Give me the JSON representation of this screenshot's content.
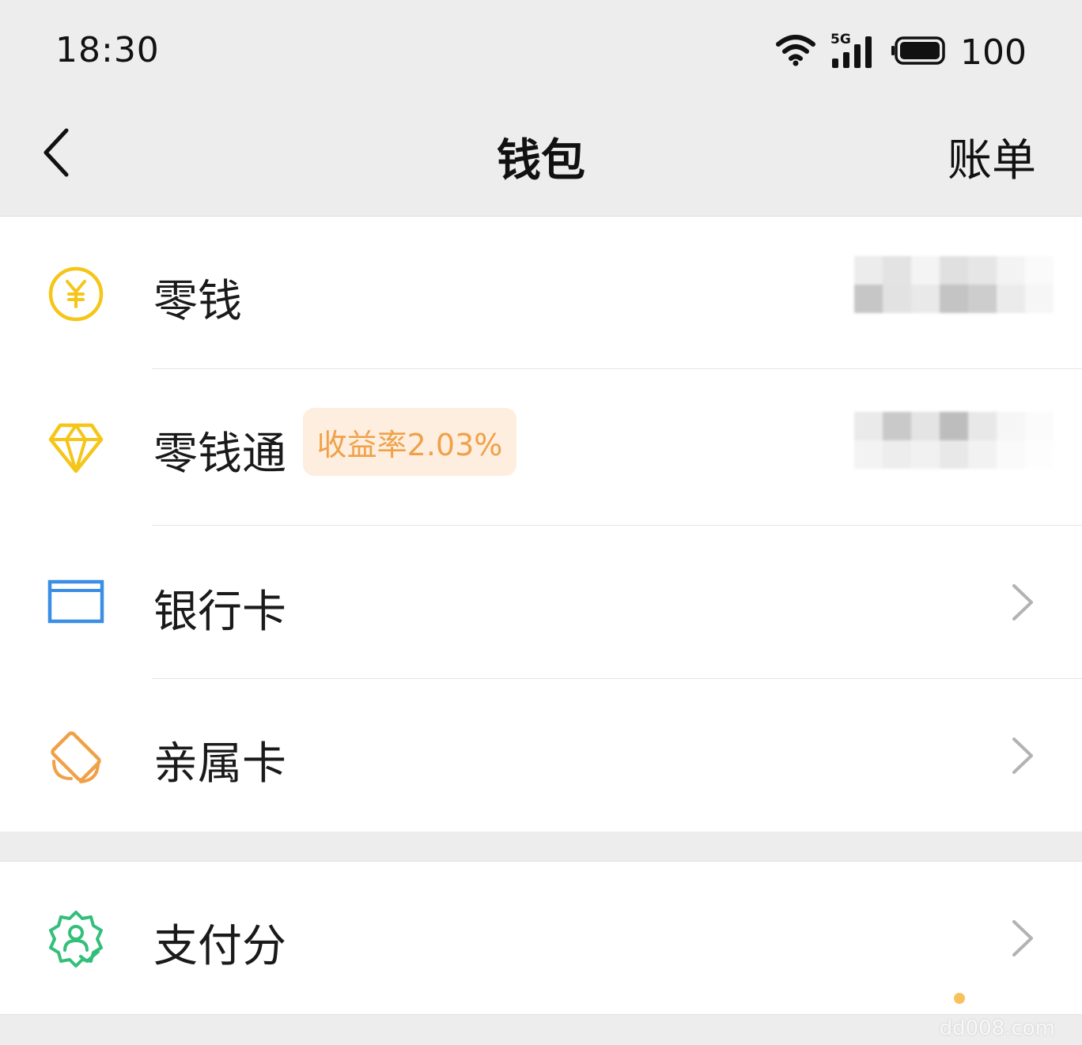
{
  "status_bar": {
    "time": "18:30",
    "network": "5G",
    "battery": "100"
  },
  "nav": {
    "title": "钱包",
    "action": "账单"
  },
  "items": [
    {
      "label": "零钱",
      "icon": "yuan-coin-icon",
      "value_hidden": true
    },
    {
      "label": "零钱通",
      "icon": "diamond-icon",
      "badge": "收益率2.03%",
      "value_hidden": true
    },
    {
      "label": "银行卡",
      "icon": "bank-card-icon"
    },
    {
      "label": "亲属卡",
      "icon": "family-card-icon"
    }
  ],
  "items_group2": [
    {
      "label": "支付分",
      "icon": "pay-score-icon"
    }
  ],
  "watermark": "dd008.com",
  "colors": {
    "background": "#ededed",
    "yellow": "#f5c518",
    "blue": "#3a8ee6",
    "orange": "#f0a148",
    "green": "#33bf7a",
    "badge_bg": "#fdeee0"
  }
}
